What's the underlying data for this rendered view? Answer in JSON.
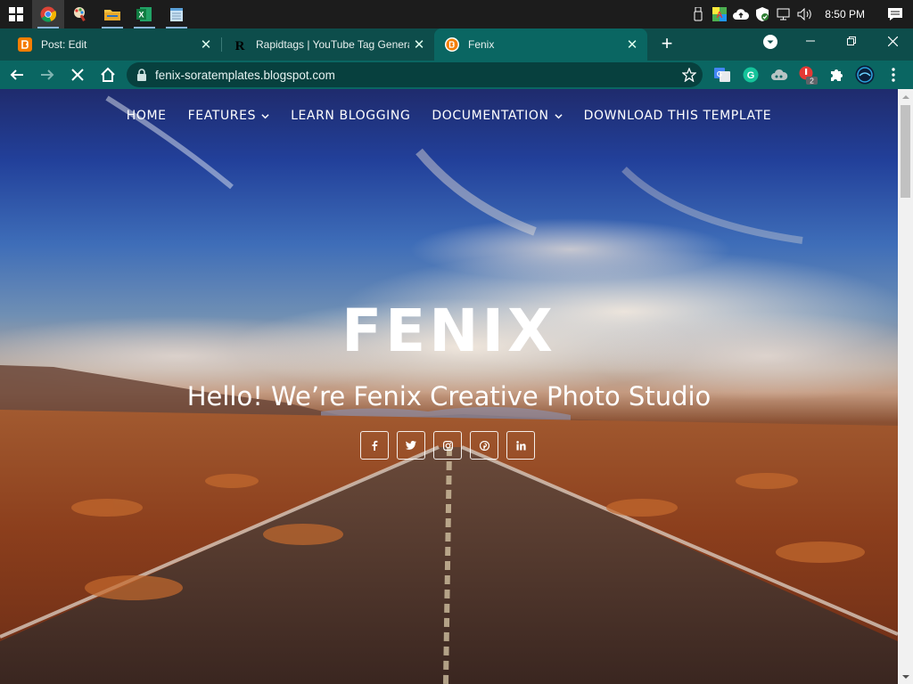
{
  "taskbar": {
    "apps": [
      {
        "name": "windows-start"
      },
      {
        "name": "chrome",
        "active": true
      },
      {
        "name": "paint"
      },
      {
        "name": "file-explorer"
      },
      {
        "name": "excel"
      },
      {
        "name": "notepad"
      }
    ],
    "time": "8:50 PM"
  },
  "tabs": [
    {
      "title": "Post: Edit",
      "favicon": "blogger-icon"
    },
    {
      "title": "Rapidtags | YouTube Tag Generator",
      "favicon": "rapidtags-icon"
    },
    {
      "title": "Fenix",
      "favicon": "blogger-icon",
      "active": true
    }
  ],
  "toolbar": {
    "url": "fenix-soratemplates.blogspot.com",
    "extension_badge": "2"
  },
  "site": {
    "nav": [
      {
        "label": "HOME",
        "dropdown": false
      },
      {
        "label": "FEATURES",
        "dropdown": true
      },
      {
        "label": "LEARN BLOGGING",
        "dropdown": false
      },
      {
        "label": "DOCUMENTATION",
        "dropdown": true
      },
      {
        "label": "DOWNLOAD THIS TEMPLATE",
        "dropdown": false
      }
    ],
    "brand": "FENIX",
    "tagline": "Hello! We’re Fenix Creative Photo Studio",
    "social": [
      {
        "name": "facebook",
        "glyph": "f"
      },
      {
        "name": "twitter",
        "glyph": "t"
      },
      {
        "name": "instagram",
        "glyph": "ig"
      },
      {
        "name": "pinterest",
        "glyph": "p"
      },
      {
        "name": "linkedin",
        "glyph": "in"
      }
    ]
  },
  "colors": {
    "tabstrip": "#0d4d4b",
    "toolbar": "#0a6662",
    "accent_blogger": "#f57d00"
  }
}
